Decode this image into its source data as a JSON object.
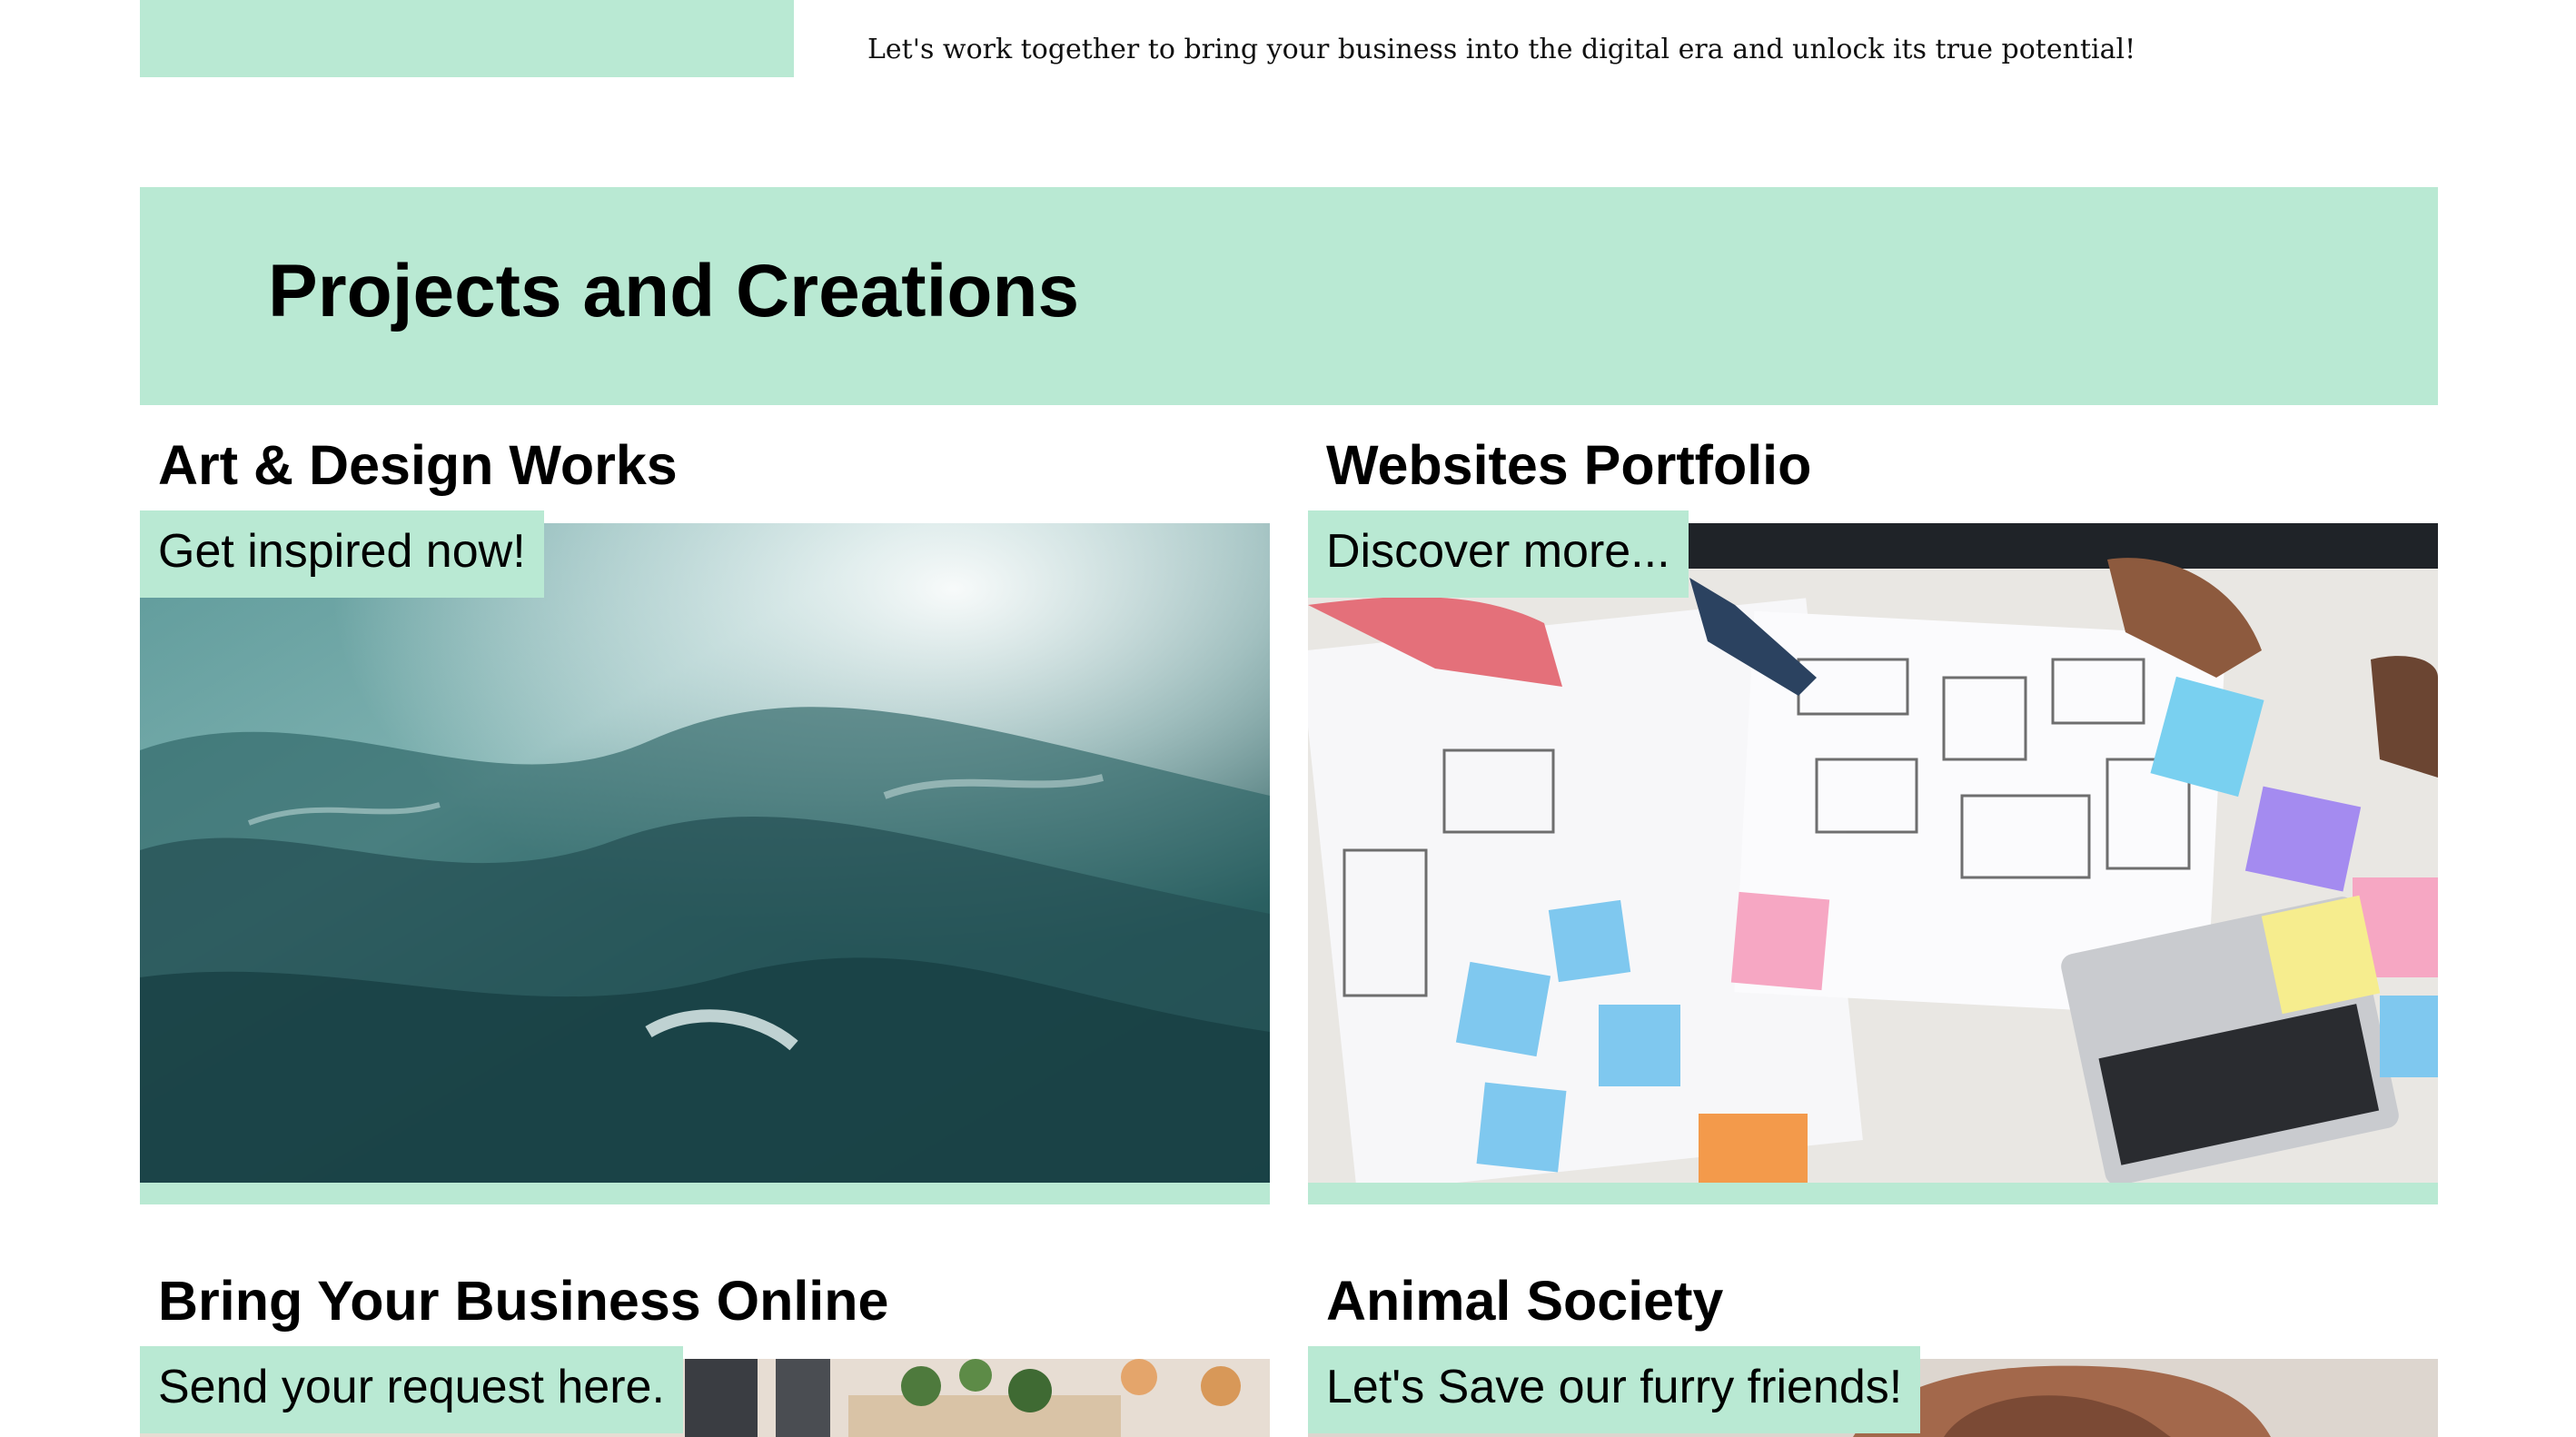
{
  "intro": {
    "text": "Let's work together to bring your business into the digital era and unlock its true potential!"
  },
  "projects": {
    "title": "Projects and Creations"
  },
  "cards": [
    {
      "title": "Art & Design Works",
      "tag": "Get inspired now!",
      "image": "ocean-waves-photo"
    },
    {
      "title": "Websites Portfolio",
      "tag": "Discover more...",
      "image": "wireframe-sketching-photo"
    },
    {
      "title": "Bring Your Business Online",
      "tag": "Send your request here.",
      "image": "cafe-interior-photo"
    },
    {
      "title": "Animal Society",
      "tag": "Let's Save our furry friends!",
      "image": "dog-photo"
    }
  ],
  "colors": {
    "accent": "#b9e9d3",
    "text": "#000000",
    "background": "#ffffff"
  }
}
